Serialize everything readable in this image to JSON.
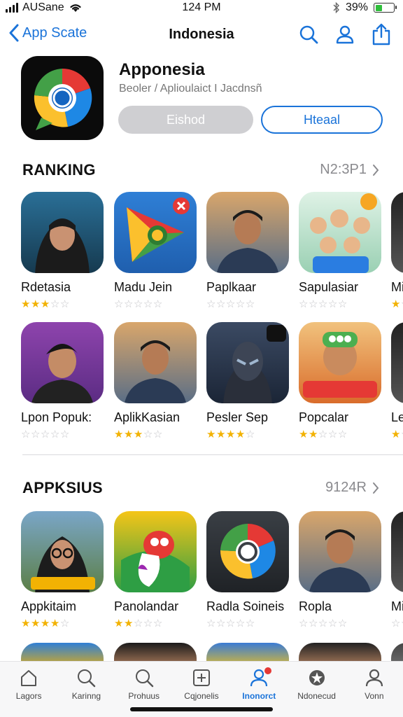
{
  "status_bar": {
    "carrier": "AUSane",
    "time": "124 PM",
    "battery": "39%",
    "battery_level": 0.39
  },
  "nav": {
    "back_label": "App Scate",
    "title": "Indonesia"
  },
  "app": {
    "name": "Apponesia",
    "subtitle": "Beoler / Aplioulaict I Jacdnsñ",
    "primary_button": "Eishod",
    "secondary_button": "Hteaal"
  },
  "ranking": {
    "title": "RANKING",
    "more": "N2:3Ρ1",
    "rows": [
      [
        {
          "name": "Rdetasia",
          "rating": 3.5,
          "icon": "portrait-hijab-icon"
        },
        {
          "name": "Madu Jein",
          "rating": 0,
          "icon": "play-triangle-icon"
        },
        {
          "name": "Paplkaar",
          "rating": 0,
          "icon": "portrait-man-icon"
        },
        {
          "name": "Sapulasiar",
          "rating": 0,
          "icon": "group-cartoon-icon"
        },
        {
          "name": "Mi",
          "rating": 1,
          "icon": "app-icon"
        }
      ],
      [
        {
          "name": "Lpon Popuk:",
          "rating": 0,
          "icon": "portrait-boy-icon"
        },
        {
          "name": "AplikKasian",
          "rating": 3.5,
          "icon": "portrait-man-icon"
        },
        {
          "name": "Pesler Sep",
          "rating": 4,
          "icon": "robot-hero-icon"
        },
        {
          "name": "Popcalar",
          "rating": 2.5,
          "icon": "cartoon-crew-icon"
        },
        {
          "name": "Le",
          "rating": 1,
          "icon": "app-icon"
        }
      ]
    ]
  },
  "apps_section": {
    "title": "APPKSIUS",
    "more": "9124R",
    "rows": [
      [
        {
          "name": "Appkitaim",
          "rating": 4,
          "icon": "portrait-hijab-glasses-icon"
        },
        {
          "name": "Panolandar",
          "rating": 2.5,
          "icon": "red-bird-icon"
        },
        {
          "name": "Radla Soineis",
          "rating": 0,
          "icon": "chrome-ring-icon"
        },
        {
          "name": "Ropla",
          "rating": 0,
          "icon": "portrait-man-icon"
        },
        {
          "name": "Mi",
          "rating": 0,
          "icon": "app-icon"
        }
      ]
    ]
  },
  "tabs": [
    {
      "label": "Lagors",
      "icon": "home-icon",
      "active": false
    },
    {
      "label": "Karinng",
      "icon": "search-icon",
      "active": false
    },
    {
      "label": "Prohuus",
      "icon": "search-icon",
      "active": false
    },
    {
      "label": "Cqjonelis",
      "icon": "plus-square-icon",
      "active": false
    },
    {
      "label": "Inonorct",
      "icon": "person-icon",
      "active": true
    },
    {
      "label": "Ndonecud",
      "icon": "badge-icon",
      "active": false
    },
    {
      "label": "Vonn",
      "icon": "person-icon",
      "active": false
    }
  ],
  "colors": {
    "accent": "#1a73d9",
    "star": "#f2b203",
    "star_empty": "#c4c4c8",
    "badge": "#e53935"
  }
}
